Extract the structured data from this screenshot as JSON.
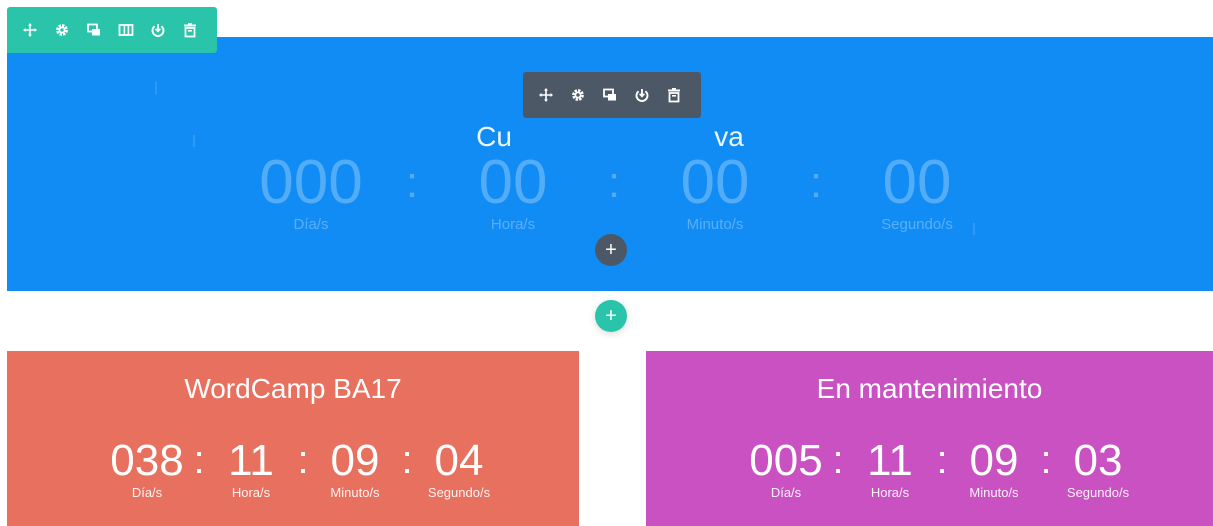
{
  "colors": {
    "section_blue": "#118cf4",
    "row_toolbar": "#29c4a9",
    "module_toolbar": "#4c5866",
    "card_red": "#e8705f",
    "card_purple": "#c951c2"
  },
  "row_toolbar": {
    "icons": [
      "move-icon",
      "settings-icon",
      "duplicate-icon",
      "columns-icon",
      "save-icon",
      "delete-icon"
    ]
  },
  "module_toolbar": {
    "icons": [
      "move-icon",
      "settings-icon",
      "duplicate-icon",
      "save-icon",
      "delete-icon"
    ]
  },
  "hero": {
    "title": "Cu                          va",
    "days": "000",
    "hours": "00",
    "minutes": "00",
    "seconds": "00",
    "separator": ":",
    "days_label": "Día/s",
    "hours_label": "Hora/s",
    "minutes_label": "Minuto/s",
    "seconds_label": "Segundo/s"
  },
  "add_module_glyph": "+",
  "add_row_glyph": "+",
  "card_left": {
    "title": "WordCamp BA17",
    "days": "038",
    "hours": "11",
    "minutes": "09",
    "seconds": "04",
    "separator": ":",
    "days_label": "Día/s",
    "hours_label": "Hora/s",
    "minutes_label": "Minuto/s",
    "seconds_label": "Segundo/s"
  },
  "card_right": {
    "title": "En mantenimiento",
    "days": "005",
    "hours": "11",
    "minutes": "09",
    "seconds": "03",
    "separator": ":",
    "days_label": "Día/s",
    "hours_label": "Hora/s",
    "minutes_label": "Minuto/s",
    "seconds_label": "Segundo/s"
  }
}
